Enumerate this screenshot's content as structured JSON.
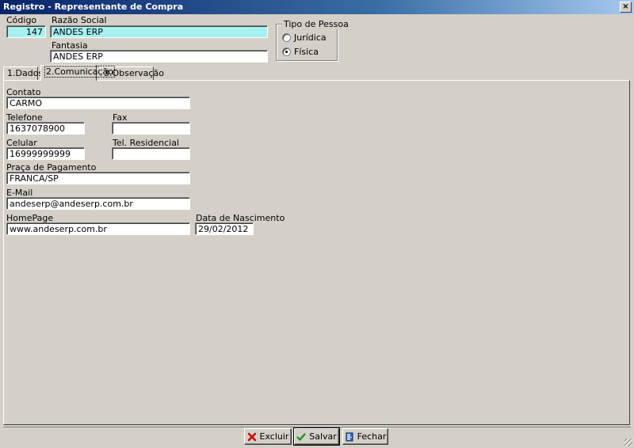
{
  "window": {
    "title": "Registro - Representante de Compra",
    "close_label": "×"
  },
  "header": {
    "codigo_label": "Código",
    "codigo_value": "147",
    "razao_label": "Razão Social",
    "razao_value": "ANDES ERP",
    "fantasia_label": "Fantasia",
    "fantasia_value": "ANDES ERP",
    "tipo_pessoa": {
      "title": "Tipo de Pessoa",
      "options": [
        {
          "label": "Jurídica",
          "checked": false
        },
        {
          "label": "Física",
          "checked": true
        }
      ]
    }
  },
  "tabs": [
    {
      "label": "1.Dados"
    },
    {
      "label": "2.Comunicação"
    },
    {
      "label": "3.Observação"
    }
  ],
  "form": {
    "contato_label": "Contato",
    "contato_value": "CARMO",
    "telefone_label": "Telefone",
    "telefone_value": "1637078900",
    "fax_label": "Fax",
    "fax_value": "",
    "celular_label": "Celular",
    "celular_value": "16999999999",
    "tel_res_label": "Tel. Residencial",
    "tel_res_value": "",
    "praca_label": "Praça de Pagamento",
    "praca_value": "FRANCA/SP",
    "email_label": "E-Mail",
    "email_value": "andeserp@andeserp.com.br",
    "homepage_label": "HomePage",
    "homepage_value": "www.andeserp.com.br",
    "nascimento_label": "Data de Nascimento",
    "nascimento_value": "29/02/2012"
  },
  "buttons": {
    "excluir_label": "Excluir",
    "excluir_icon": "x-icon",
    "excluir_color": "#cc0000",
    "salvar_label": "Salvar",
    "salvar_icon": "check-icon",
    "salvar_color": "#1a8f1a",
    "fechar_label": "Fechar",
    "fechar_icon": "door-icon"
  }
}
